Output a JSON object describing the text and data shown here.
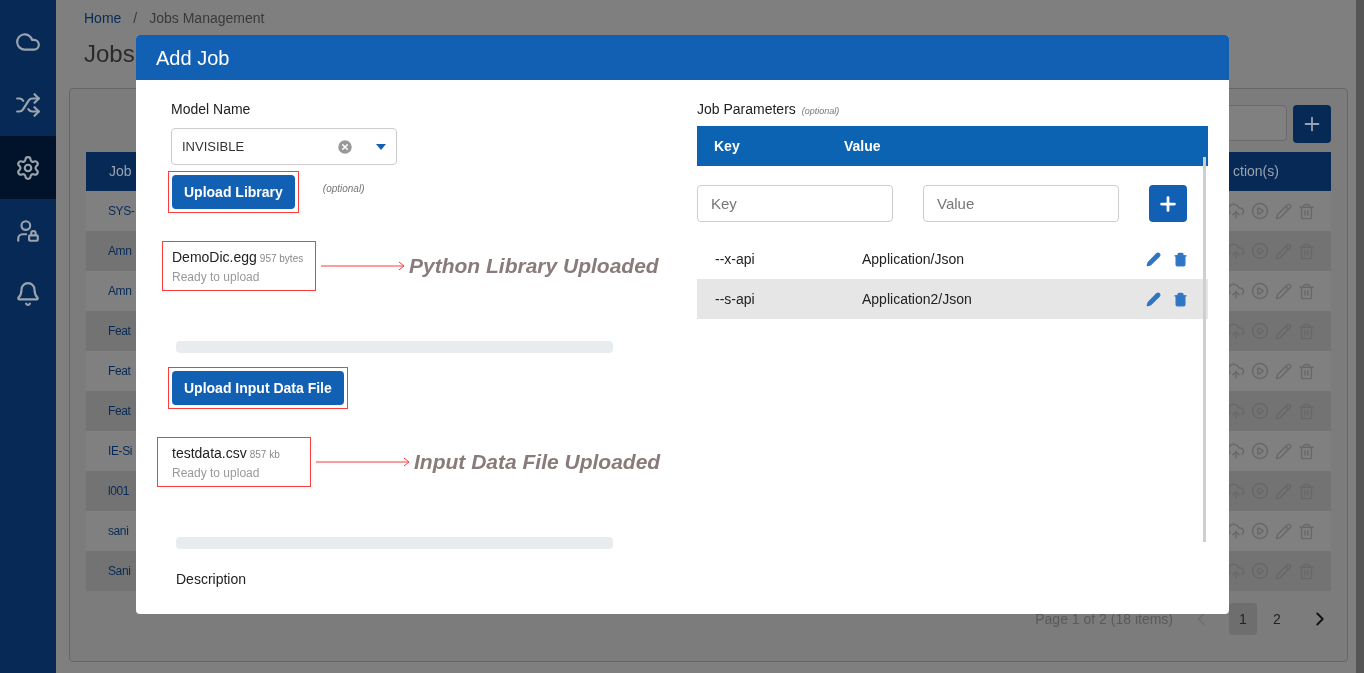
{
  "sidebar": {
    "items": [
      {
        "selected": false
      },
      {
        "selected": false
      },
      {
        "selected": true
      },
      {
        "selected": false
      },
      {
        "selected": false
      }
    ]
  },
  "breadcrumb": {
    "items": [
      "Home",
      "Jobs Management"
    ],
    "separator": "/"
  },
  "page_title": "Jobs",
  "jobs_table": {
    "columns": [
      "Job",
      "ction(s)"
    ],
    "rows": [
      {
        "name": "SYS-"
      },
      {
        "name": "Amn"
      },
      {
        "name": "Amn"
      },
      {
        "name": "Feat"
      },
      {
        "name": "Feat"
      },
      {
        "name": "Feat"
      },
      {
        "name": "IE-Si"
      },
      {
        "name": "l001"
      },
      {
        "name": "sani"
      },
      {
        "name": "Sani"
      }
    ]
  },
  "pagination": {
    "summary": "Page 1 of 2 (18 items)",
    "pages": [
      {
        "label": "1",
        "selected": true
      },
      {
        "label": "2",
        "selected": false
      }
    ]
  },
  "dialog": {
    "title": "Add Job",
    "model_name": {
      "label": "Model Name",
      "value": "INVISIBLE"
    },
    "uploads": [
      {
        "button": "Upload Library",
        "optional": "(optional)",
        "file": {
          "name": "DemoDic.egg",
          "size": "957 bytes",
          "status": "Ready to upload"
        },
        "annotation": "Python Library Uploaded",
        "level": 0
      },
      {
        "button": "Upload Input Data File",
        "file": {
          "name": "testdata.csv",
          "size": "857 kb",
          "status": "Ready to upload"
        },
        "annotation": "Input Data File Uploaded",
        "level": 0
      }
    ],
    "description_label": "Description",
    "job_parameters": {
      "label": "Job Parameters",
      "optional": "(optional)",
      "columns": [
        "Key",
        "Value"
      ],
      "key_placeholder": "Key",
      "value_placeholder": "Value",
      "rows": [
        {
          "key": "--x-api",
          "value": "Application/Json",
          "selected": false
        },
        {
          "key": "--s-api",
          "value": "Application2/Json",
          "selected": true
        }
      ]
    }
  }
}
